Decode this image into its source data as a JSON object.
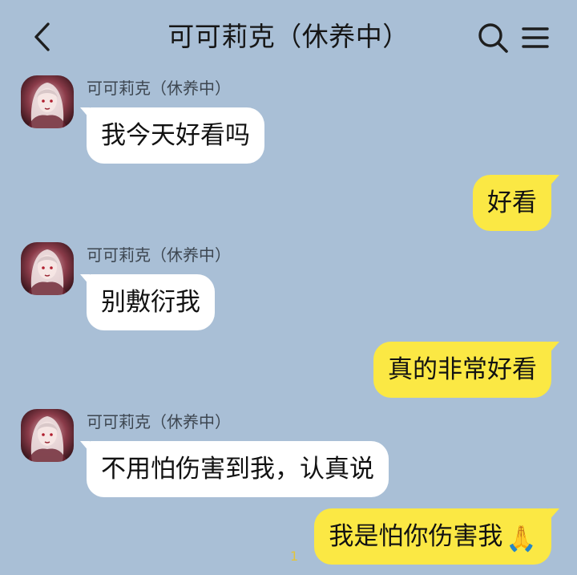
{
  "header": {
    "title": "可可莉克（休养中）",
    "back_icon": "chevron-left-icon",
    "search_icon": "search-icon",
    "menu_icon": "menu-icon"
  },
  "colors": {
    "background": "#a9bfd6",
    "incoming_bubble": "#ffffff",
    "outgoing_bubble": "#fbe844"
  },
  "messages": [
    {
      "direction": "in",
      "sender": "可可莉克（休养中）",
      "text": "我今天好看吗"
    },
    {
      "direction": "out",
      "text": "好看"
    },
    {
      "direction": "in",
      "sender": "可可莉克（休养中）",
      "text": "别敷衍我"
    },
    {
      "direction": "out",
      "text": "真的非常好看"
    },
    {
      "direction": "in",
      "sender": "可可莉克（休养中）",
      "text": "不用怕伤害到我，认真说"
    },
    {
      "direction": "out",
      "text": "我是怕你伤害我",
      "emoji": "🙏"
    }
  ],
  "unread_count": "1"
}
